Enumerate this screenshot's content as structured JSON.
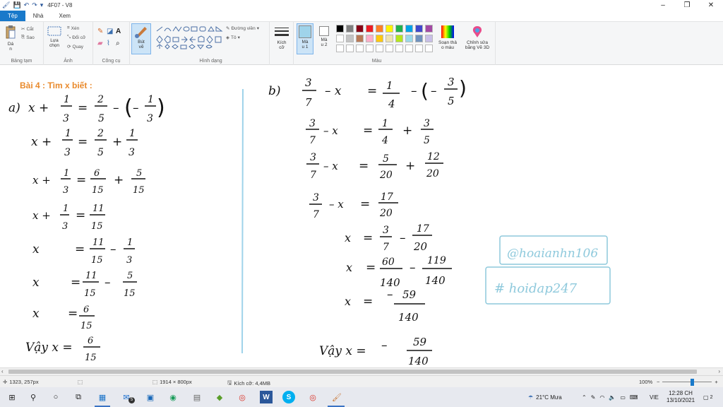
{
  "window": {
    "title": "4F07 - V8",
    "minimize": "–",
    "maximize": "❐",
    "close": "✕"
  },
  "tabs": [
    "Tệp",
    "Nhà",
    "Xem"
  ],
  "ribbon": {
    "groups": {
      "clipboard": "Bảng tạm",
      "image": "Ảnh",
      "tools": "Công cụ",
      "brushes": "Bút vẽ",
      "shapes": "Hình dạng",
      "colors": "Màu"
    },
    "buttons": {
      "paste": "Dá\nn",
      "cut": "Cắt",
      "copy": "Sao",
      "select": "Lựa\nchọn",
      "crop": "Xén",
      "resize": "Đổi cỡ",
      "rotate": "Quay",
      "brush": "Bút\nvẽ",
      "outline": "Đường viền",
      "fill": "Tô",
      "size": "Kích\ncỡ",
      "color1": "Mà\nu 1",
      "color2": "Mà\nu 2",
      "edit_colors": "Soạn thả\no màu",
      "paint3d": "Chỉnh sửa\nbằng Vẽ 3D"
    },
    "palette": [
      "#000000",
      "#7f7f7f",
      "#880015",
      "#ed1c24",
      "#ff7f27",
      "#fff200",
      "#22b14c",
      "#00a2e8",
      "#3f48cc",
      "#a349a4",
      "#ffffff",
      "#c3c3c3",
      "#b97a57",
      "#ffaec9",
      "#ffc90e",
      "#efe4b0",
      "#b5e61d",
      "#99d9ea",
      "#7092be",
      "#c8bfe7"
    ],
    "color1": "#9fd3ea",
    "color2": "#ffffff"
  },
  "canvas": {
    "heading": "Bài 4 : Tìm x biết :",
    "heading_color": "#e98a2c",
    "part_a": {
      "label": "a)",
      "lines": [
        {
          "lhs": "x + 1/3",
          "rhs": "= 2/5 – (–1/3)"
        },
        {
          "lhs": "x + 1/3",
          "rhs": "= 2/5 + 1/3"
        },
        {
          "lhs": "x + 1/3",
          "rhs": "= 6/15 + 5/15"
        },
        {
          "lhs": "x + 1/3",
          "rhs": "= 11/15"
        },
        {
          "lhs": "x",
          "rhs": "= 11/15 – 1/3"
        },
        {
          "lhs": "x",
          "rhs": "= 11/15 – 5/15"
        },
        {
          "lhs": "x",
          "rhs": "= 6/15"
        }
      ],
      "answer": "Vậy x = 6/15"
    },
    "part_b": {
      "label": "b)",
      "lines": [
        "3/7 – x = 1/4 – (–3/5)",
        "3/7 – x = 1/4 + 3/5",
        "3/7 – x = 5/20 + 12/20",
        "3/7 – x = 17/20",
        "x = 3/7 – 17/20",
        "x = 60/140 – 119/140",
        "x = –59/140"
      ],
      "answer": "Vậy x = –59/140"
    },
    "watermark_user": "@hoaianhn106",
    "watermark_site": "# hoidap247",
    "watermark_color": "#8ec9dc"
  },
  "status": {
    "cursor": "1323, 257px",
    "dimensions": "1914 × 800px",
    "filesize": "Kích cỡ: 4,4MB",
    "zoom": "100%"
  },
  "taskbar": {
    "weather": "21°C  Mưa",
    "language": "VIE",
    "time": "12:28 CH",
    "date": "13/10/2021",
    "notifications": "2",
    "mail_badge": "5"
  }
}
